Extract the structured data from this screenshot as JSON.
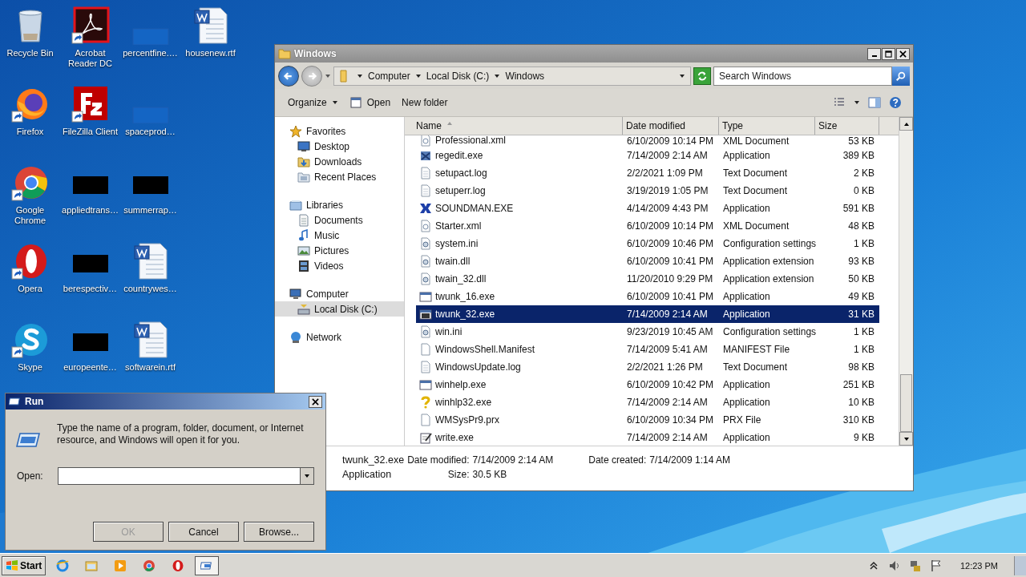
{
  "desktop": {
    "rows": [
      [
        {
          "label": "Recycle Bin",
          "kind": "recycle",
          "shortcut": false
        },
        {
          "label": "Acrobat Reader DC",
          "kind": "acrobat",
          "shortcut": true
        },
        {
          "label": "percentfine.…",
          "kind": "blank",
          "shortcut": false
        },
        {
          "label": "housenew.rtf",
          "kind": "word",
          "shortcut": false
        }
      ],
      [
        {
          "label": "Firefox",
          "kind": "firefox",
          "shortcut": true
        },
        {
          "label": "FileZilla Client",
          "kind": "filezilla",
          "shortcut": true
        },
        {
          "label": "spaceprod…",
          "kind": "blank",
          "shortcut": false
        }
      ],
      [
        {
          "label": "Google Chrome",
          "kind": "chrome",
          "shortcut": true
        },
        {
          "label": "appliedtrans…",
          "kind": "redacted",
          "shortcut": false
        },
        {
          "label": "summerrap…",
          "kind": "redacted",
          "shortcut": false
        }
      ],
      [
        {
          "label": "Opera",
          "kind": "opera",
          "shortcut": true
        },
        {
          "label": "berespectiv…",
          "kind": "redacted",
          "shortcut": false
        },
        {
          "label": "countrywes…",
          "kind": "word",
          "shortcut": false
        }
      ],
      [
        {
          "label": "Skype",
          "kind": "skype",
          "shortcut": true
        },
        {
          "label": "europeente…",
          "kind": "redacted",
          "shortcut": false
        },
        {
          "label": "softwarein.rtf",
          "kind": "word",
          "shortcut": false
        }
      ]
    ]
  },
  "explorer": {
    "title": "Windows",
    "breadcrumb": [
      "Computer",
      "Local Disk (C:)",
      "Windows"
    ],
    "search": {
      "placeholder": "Search Windows"
    },
    "toolbar": [
      "Organize",
      "Open",
      "New folder"
    ],
    "nav": [
      {
        "label": "Favorites",
        "kind": "star",
        "selected": false,
        "children": [
          {
            "label": "Desktop",
            "kind": "desktop",
            "selected": false
          },
          {
            "label": "Downloads",
            "kind": "downloads",
            "selected": false
          },
          {
            "label": "Recent Places",
            "kind": "recent",
            "selected": false
          }
        ]
      },
      {
        "label": "Libraries",
        "kind": "library",
        "selected": false,
        "children": [
          {
            "label": "Documents",
            "kind": "documents",
            "selected": false
          },
          {
            "label": "Music",
            "kind": "music",
            "selected": false
          },
          {
            "label": "Pictures",
            "kind": "pictures",
            "selected": false
          },
          {
            "label": "Videos",
            "kind": "videos",
            "selected": false
          }
        ]
      },
      {
        "label": "Computer",
        "kind": "computer",
        "selected": false,
        "children": [
          {
            "label": "Local Disk (C:)",
            "kind": "disk",
            "selected": true
          }
        ]
      },
      {
        "label": "Network",
        "kind": "network",
        "selected": false
      }
    ],
    "columns": [
      "Name",
      "Date modified",
      "Type",
      "Size"
    ],
    "files": [
      {
        "name": "Professional.xml",
        "date": "6/10/2009 10:14 PM",
        "type": "XML Document",
        "size": "53 KB",
        "kind": "xml",
        "selected": false
      },
      {
        "name": "regedit.exe",
        "date": "7/14/2009 2:14 AM",
        "type": "Application",
        "size": "389 KB",
        "kind": "regedit",
        "selected": false
      },
      {
        "name": "setupact.log",
        "date": "2/2/2021 1:09 PM",
        "type": "Text Document",
        "size": "2 KB",
        "kind": "text",
        "selected": false
      },
      {
        "name": "setuperr.log",
        "date": "3/19/2019 1:05 PM",
        "type": "Text Document",
        "size": "0 KB",
        "kind": "text",
        "selected": false
      },
      {
        "name": "SOUNDMAN.EXE",
        "date": "4/14/2009 4:43 PM",
        "type": "Application",
        "size": "591 KB",
        "kind": "soundman",
        "selected": false
      },
      {
        "name": "Starter.xml",
        "date": "6/10/2009 10:14 PM",
        "type": "XML Document",
        "size": "48 KB",
        "kind": "xml",
        "selected": false
      },
      {
        "name": "system.ini",
        "date": "6/10/2009 10:46 PM",
        "type": "Configuration settings",
        "size": "1 KB",
        "kind": "ini",
        "selected": false
      },
      {
        "name": "twain.dll",
        "date": "6/10/2009 10:41 PM",
        "type": "Application extension",
        "size": "93 KB",
        "kind": "dll",
        "selected": false
      },
      {
        "name": "twain_32.dll",
        "date": "11/20/2010 9:29 PM",
        "type": "Application extension",
        "size": "50 KB",
        "kind": "dll",
        "selected": false
      },
      {
        "name": "twunk_16.exe",
        "date": "6/10/2009 10:41 PM",
        "type": "Application",
        "size": "49 KB",
        "kind": "app",
        "selected": false
      },
      {
        "name": "twunk_32.exe",
        "date": "7/14/2009 2:14 AM",
        "type": "Application",
        "size": "31 KB",
        "kind": "app",
        "selected": true
      },
      {
        "name": "win.ini",
        "date": "9/23/2019 10:45 AM",
        "type": "Configuration settings",
        "size": "1 KB",
        "kind": "ini",
        "selected": false
      },
      {
        "name": "WindowsShell.Manifest",
        "date": "7/14/2009 5:41 AM",
        "type": "MANIFEST File",
        "size": "1 KB",
        "kind": "blank",
        "selected": false
      },
      {
        "name": "WindowsUpdate.log",
        "date": "2/2/2021 1:26 PM",
        "type": "Text Document",
        "size": "98 KB",
        "kind": "text",
        "selected": false
      },
      {
        "name": "winhelp.exe",
        "date": "6/10/2009 10:42 PM",
        "type": "Application",
        "size": "251 KB",
        "kind": "app",
        "selected": false
      },
      {
        "name": "winhlp32.exe",
        "date": "7/14/2009 2:14 AM",
        "type": "Application",
        "size": "10 KB",
        "kind": "help",
        "selected": false
      },
      {
        "name": "WMSysPr9.prx",
        "date": "6/10/2009 10:34 PM",
        "type": "PRX File",
        "size": "310 KB",
        "kind": "blank",
        "selected": false
      },
      {
        "name": "write.exe",
        "date": "7/14/2009 2:14 AM",
        "type": "Application",
        "size": "9 KB",
        "kind": "write",
        "selected": false
      }
    ],
    "details": {
      "name": "twunk_32.exe",
      "type": "Application",
      "modified_label": "Date modified:",
      "modified": "7/14/2009 2:14 AM",
      "created_label": "Date created:",
      "created": "7/14/2009 1:14 AM",
      "size_label": "Size:",
      "size": "30.5 KB"
    }
  },
  "run": {
    "title": "Run",
    "message": "Type the name of a program, folder, document, or Internet resource, and Windows will open it for you.",
    "open_label": "Open:",
    "buttons": [
      {
        "label": "OK",
        "disabled": true
      },
      {
        "label": "Cancel",
        "disabled": false
      },
      {
        "label": "Browse...",
        "disabled": false
      }
    ]
  },
  "taskbar": {
    "start": "Start",
    "apps": [
      {
        "kind": "ie",
        "selected": false
      },
      {
        "kind": "explorer",
        "selected": false
      },
      {
        "kind": "media",
        "selected": false
      },
      {
        "kind": "chrome",
        "selected": false
      },
      {
        "kind": "opera",
        "selected": false
      },
      {
        "kind": "run",
        "selected": true
      }
    ],
    "clock": "12:23 PM"
  }
}
